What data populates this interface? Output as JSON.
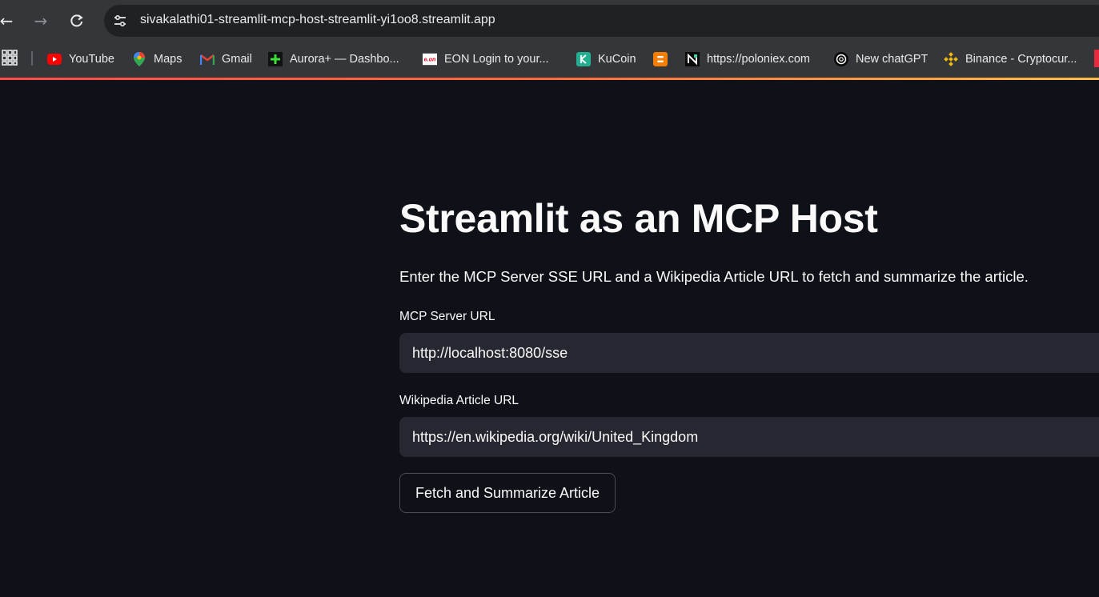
{
  "browser": {
    "url": "sivakalathi01-streamlit-mcp-host-streamlit-yi1oo8.streamlit.app",
    "bookmarks": [
      {
        "label": "YouTube",
        "icon": "youtube-icon"
      },
      {
        "label": "Maps",
        "icon": "maps-icon"
      },
      {
        "label": "Gmail",
        "icon": "gmail-icon"
      },
      {
        "label": "Aurora+ — Dashbo...",
        "icon": "aurora-icon"
      },
      {
        "label": "EON Login to your...",
        "icon": "eon-icon"
      },
      {
        "label": "KuCoin",
        "icon": "kucoin-icon"
      },
      {
        "label": "",
        "icon": "blogger-icon"
      },
      {
        "label": "https://poloniex.com",
        "icon": "poloniex-icon"
      },
      {
        "label": "New chatGPT",
        "icon": "chatgpt-icon"
      },
      {
        "label": "Binance - Cryptocur...",
        "icon": "binance-icon"
      }
    ],
    "accent_gradient": [
      "#ff4b4b",
      "#ffbd45"
    ]
  },
  "app": {
    "title": "Streamlit as an MCP Host",
    "description": "Enter the MCP Server SSE URL and a Wikipedia Article URL to fetch and summarize the article.",
    "mcp_server": {
      "label": "MCP Server URL",
      "value": "http://localhost:8080/sse"
    },
    "wikipedia": {
      "label": "Wikipedia Article URL",
      "value": "https://en.wikipedia.org/wiki/United_Kingdom"
    },
    "submit_label": "Fetch and Summarize Article"
  },
  "colors": {
    "app_background": "#0e1117",
    "input_background": "#262730",
    "chrome_background": "#35363a"
  }
}
